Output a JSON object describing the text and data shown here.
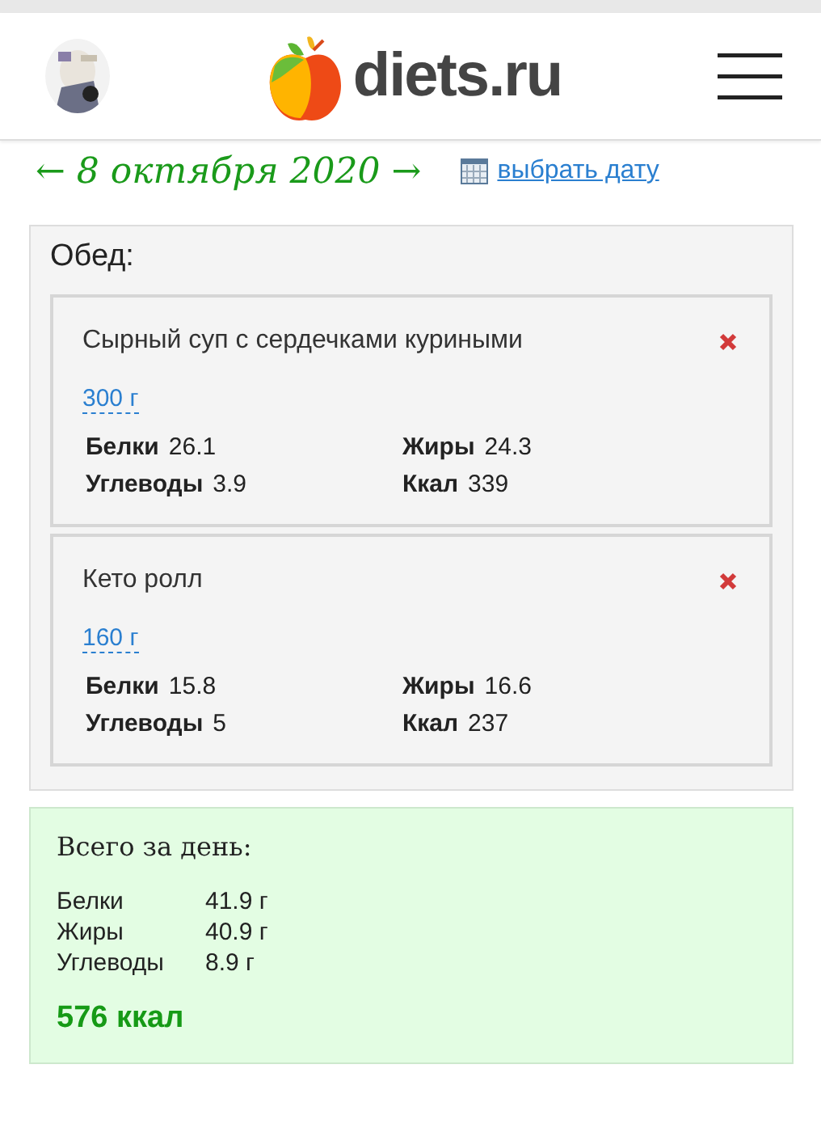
{
  "header": {
    "logo": "diets.ru"
  },
  "date_nav": {
    "date": "← 8 октября 2020 →",
    "pick_date": "выбрать дату"
  },
  "meal": {
    "title": "Обед:",
    "items": [
      {
        "name": "Сырный суп с сердечками куриными",
        "portion": "300 г",
        "nutrients": [
          {
            "label": "Белки",
            "value": "26.1"
          },
          {
            "label": "Жиры",
            "value": "24.3"
          },
          {
            "label": "Углеводы",
            "value": "3.9"
          },
          {
            "label": "Ккал",
            "value": "339"
          }
        ]
      },
      {
        "name": "Кето ролл",
        "portion": "160 г",
        "nutrients": [
          {
            "label": "Белки",
            "value": "15.8"
          },
          {
            "label": "Жиры",
            "value": "16.6"
          },
          {
            "label": "Углеводы",
            "value": "5"
          },
          {
            "label": "Ккал",
            "value": "237"
          }
        ]
      }
    ]
  },
  "day_total": {
    "title": "Всего за день:",
    "rows": [
      {
        "label": "Белки",
        "value": "41.9 г"
      },
      {
        "label": "Жиры",
        "value": "40.9 г"
      },
      {
        "label": "Углеводы",
        "value": "8.9 г"
      }
    ],
    "calories": "576 ккал"
  }
}
